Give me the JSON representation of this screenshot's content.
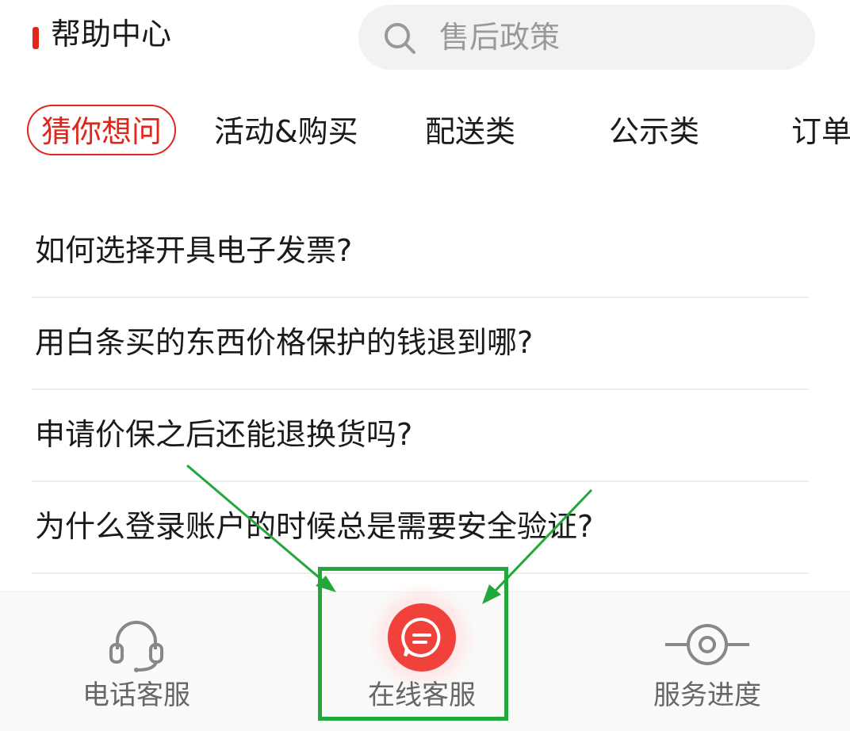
{
  "header": {
    "title": "帮助中心",
    "search_placeholder": "售后政策"
  },
  "tabs": [
    {
      "label": "猜你想问",
      "active": true
    },
    {
      "label": "活动&购买",
      "active": false
    },
    {
      "label": "配送类",
      "active": false
    },
    {
      "label": "公示类",
      "active": false
    },
    {
      "label": "订单",
      "active": false
    }
  ],
  "faq": [
    {
      "question": "如何选择开具电子发票?"
    },
    {
      "question": "用白条买的东西价格保护的钱退到哪?"
    },
    {
      "question": "申请价保之后还能退换货吗?"
    },
    {
      "question": "为什么登录账户的时候总是需要安全验证?"
    }
  ],
  "bottom_nav": [
    {
      "label": "电话客服",
      "icon": "headset-icon"
    },
    {
      "label": "在线客服",
      "icon": "chat-bubble-icon"
    },
    {
      "label": "服务进度",
      "icon": "progress-icon"
    }
  ],
  "colors": {
    "accent": "#e1251b",
    "chat_button": "#f0423a",
    "highlight": "#22a83a"
  }
}
